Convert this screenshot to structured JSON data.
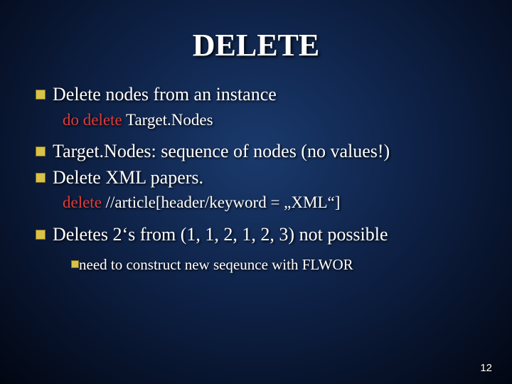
{
  "title": "DELETE",
  "bullets": {
    "b1": "Delete nodes from an instance",
    "code1_red": "do delete ",
    "code1_white": "Target.Nodes",
    "b2_part1": "Target.Nodes: sequence of nodes (no values!)",
    "b3": "Delete XML papers.",
    "code2_red": "delete ",
    "code2_white": "//article[header/keyword = „XML“]",
    "b4": "Deletes 2‘s from (1, 1, 2, 1, 2, 3) not possible",
    "b5": "need to construct new seqeunce with FLWOR"
  },
  "page_number": "12"
}
